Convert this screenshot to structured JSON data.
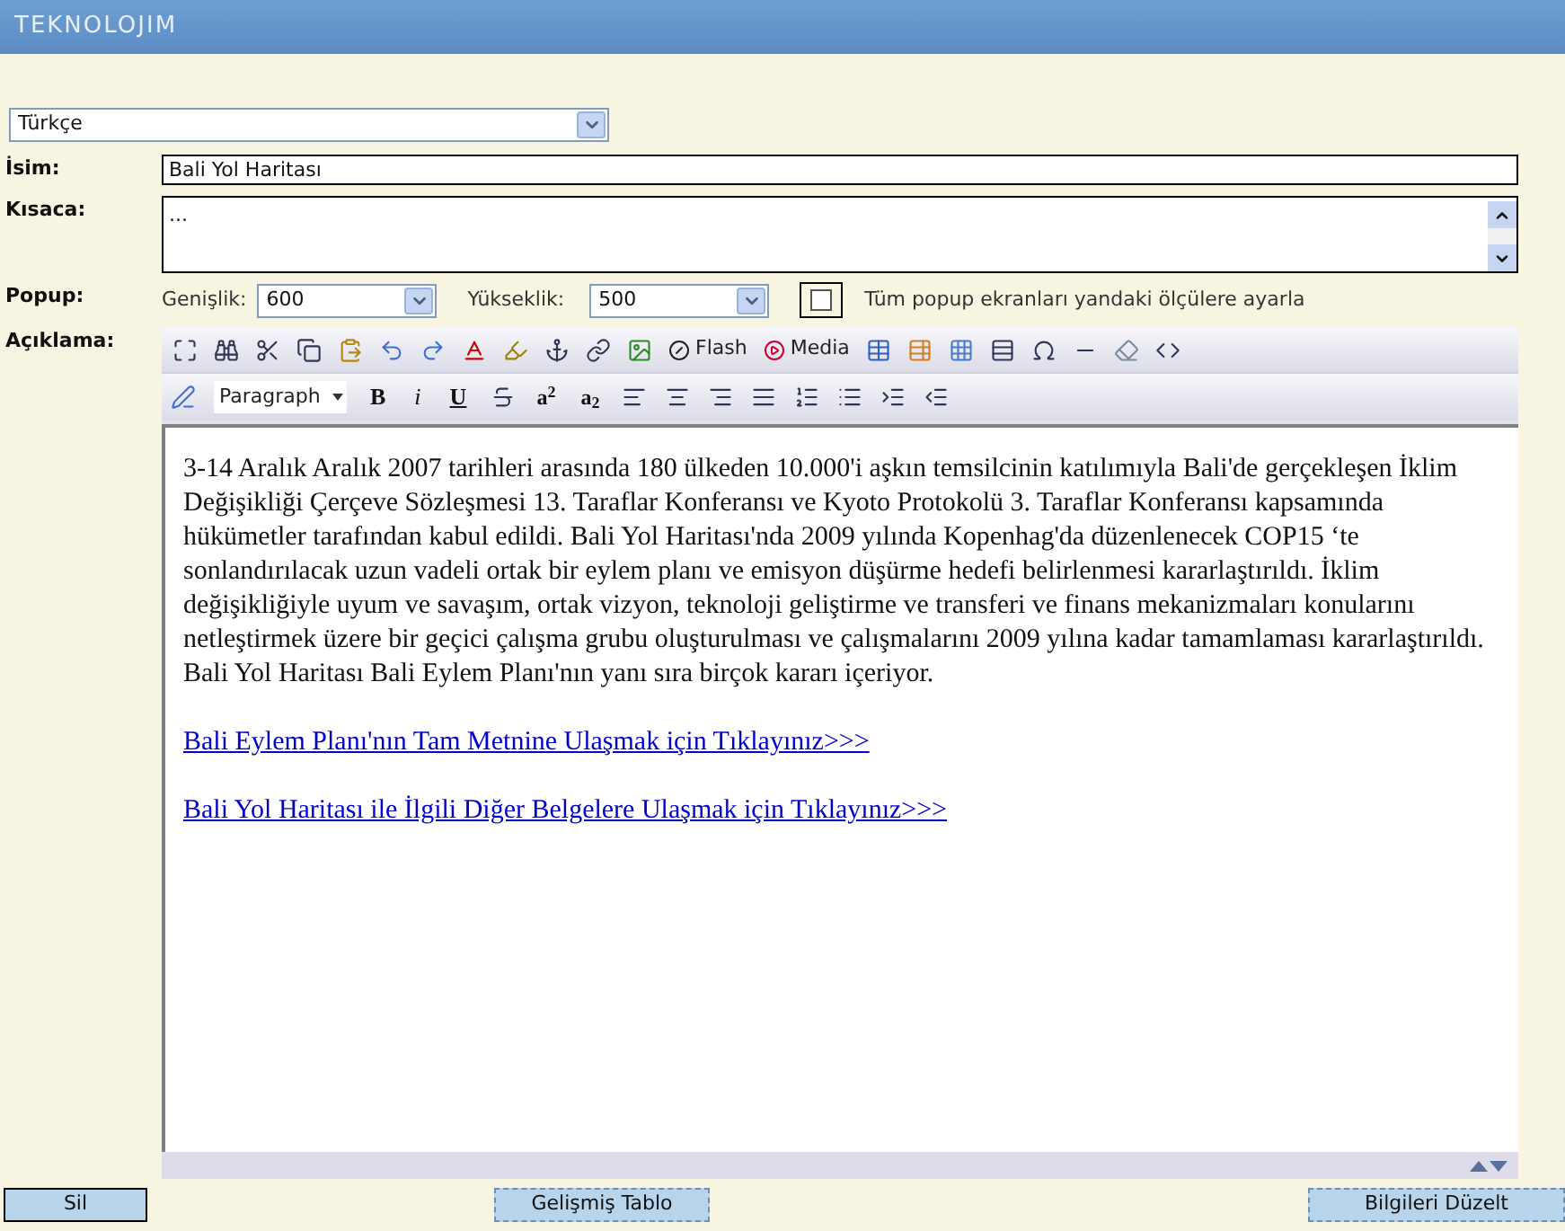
{
  "header": {
    "logo": "TEKNOLOJIM"
  },
  "language_select": {
    "value": "Türkçe"
  },
  "form": {
    "name_label": "İsim:",
    "name_value": "Bali Yol Haritası",
    "summary_label": "Kısaca:",
    "summary_value": "...",
    "popup_label": "Popup:",
    "width_label": "Genişlik:",
    "width_value": "600",
    "height_label": "Yükseklik:",
    "height_value": "500",
    "resize_all": {
      "label": "Tüm popup ekranları yandaki ölçülere ayarla",
      "checked": false
    },
    "description_label": "Açıklama:"
  },
  "editor": {
    "toolbar_labels": {
      "flash": "Flash",
      "media": "Media"
    },
    "format_select": "Paragraph",
    "format_buttons": [
      {
        "label": "B",
        "kind": "bold"
      },
      {
        "label": "i",
        "kind": "italic"
      },
      {
        "label": "U",
        "kind": "underline"
      }
    ],
    "script_buttons": [
      "a$^{2}$",
      "a$_{2}$"
    ],
    "paragraphs": [
      {
        "kind": "text",
        "text": "3-14 Aralık Aralık 2007 tarihleri arasında 180 ülkeden 10.000'i aşkın temsilcinin katılımıyla Bali'de gerçekleşen İklim Değişikliği Çerçeve Sözleşmesi 13. Taraflar Konferansı ve Kyoto Protokolü 3. Taraflar Konferansı kapsamında hükümetler tarafından kabul edildi. Bali Yol Haritası'nda 2009 yılında Kopenhag'da düzenlenecek COP15 ‘te sonlandırılacak uzun vadeli ortak bir eylem planı ve emisyon düşürme hedefi belirlenmesi kararlaştırıldı. İklim değişikliğiyle uyum ve savaşım, ortak vizyon, teknoloji geliştirme ve transferi ve finans mekanizmaları konularını netleştirmek üzere bir geçici çalışma grubu oluşturulması ve çalışmalarını 2009 yılına kadar tamamlaması kararlaştırıldı. Bali Yol Haritası Bali Eylem Planı'nın yanı sıra birçok kararı içeriyor."
      },
      {
        "kind": "link",
        "text": "Bali Eylem Planı'nın Tam Metnine Ulaşmak için Tıklayınız>>>"
      },
      {
        "kind": "link",
        "text": "Bali Yol Haritası ile İlgili Diğer Belgelere Ulaşmak için Tıklayınız>>>"
      }
    ]
  },
  "buttons": [
    {
      "label": "Sil",
      "focused": true
    },
    {
      "label": "Gelişmiş Tablo",
      "focused": false
    },
    {
      "label": "Bilgileri Düzelt",
      "focused": false
    }
  ]
}
